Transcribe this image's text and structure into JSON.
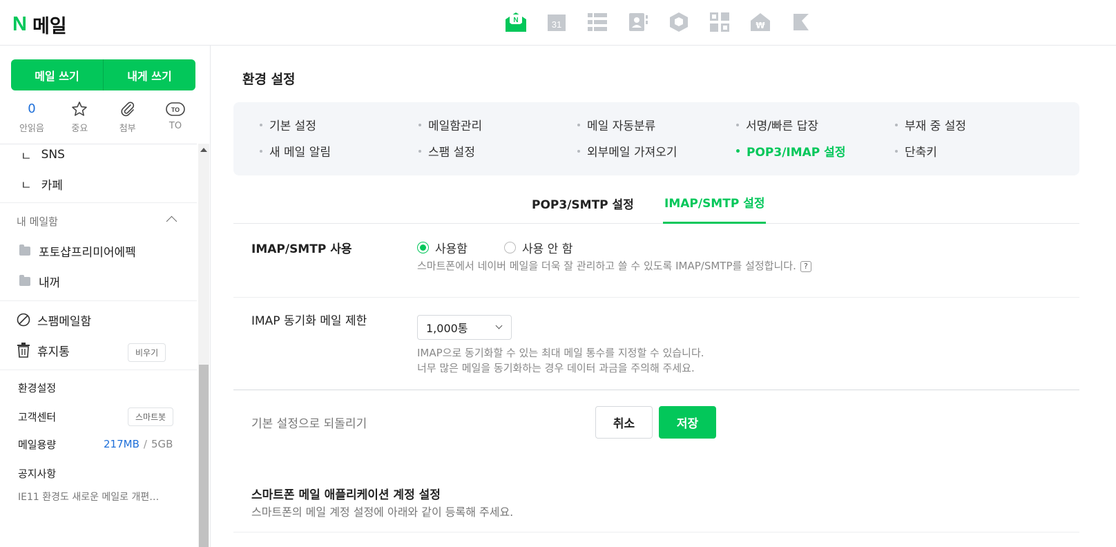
{
  "header": {
    "logo_letter": "N",
    "app_title": "메일",
    "apps": [
      "mail-icon",
      "calendar-icon",
      "list-icon",
      "contacts-icon",
      "box-icon",
      "grid-icon",
      "pay-icon",
      "bookmark-icon"
    ],
    "calendar_day": "31"
  },
  "sidebar": {
    "compose_label": "메일 쓰기",
    "self_label": "내게 쓰기",
    "quick": [
      {
        "value": "0",
        "label": "안읽음"
      },
      {
        "icon": "star-icon",
        "label": "중요"
      },
      {
        "icon": "clip-icon",
        "label": "첨부"
      },
      {
        "icon": "to-icon",
        "icon_text": "TO",
        "label": "TO"
      }
    ],
    "sub_items": [
      "SNS",
      "카페"
    ],
    "my_mailbox_label": "내 메일함",
    "folders": [
      "포토샵프리미어에펙",
      "내꺼"
    ],
    "spam_label": "스팸메일함",
    "trash_label": "휴지통",
    "trash_btn": "비우기",
    "settings_label": "환경설정",
    "support_label": "고객센터",
    "support_btn": "스마트봇",
    "storage_label": "메일용량",
    "storage_used": "217MB",
    "storage_sep": "/",
    "storage_total": "5GB",
    "notice_label": "공지사항",
    "notice_text": "IE11 환경도 새로운 메일로 개편…"
  },
  "main": {
    "title": "환경 설정",
    "menu": [
      [
        "기본 설정",
        "메일함관리",
        "메일 자동분류",
        "서명/빠른 답장",
        "부재 중 설정"
      ],
      [
        "새 메일 알림",
        "스팸 설정",
        "외부메일 가져오기",
        "POP3/IMAP 설정",
        "단축키"
      ]
    ],
    "tabs": [
      "POP3/SMTP 설정",
      "IMAP/SMTP 설정"
    ],
    "imap_use_label": "IMAP/SMTP 사용",
    "radio_on": "사용함",
    "radio_off": "사용 안 함",
    "imap_desc": "스마트폰에서 네이버 메일을 더욱 잘 관리하고 쓸 수 있도록 IMAP/SMTP를 설정합니다.",
    "help_glyph": "?",
    "sync_label": "IMAP 동기화 메일 제한",
    "sync_value": "1,000통",
    "sync_desc1": "IMAP으로 동기화할 수 있는 최대 메일 통수를 지정할 수 있습니다.",
    "sync_desc2": "너무 많은 메일을 동기화하는 경우 데이터 과금을 주의해 주세요.",
    "reset_label": "기본 설정으로 되돌리기",
    "cancel_label": "취소",
    "save_label": "저장",
    "section_title": "스마트폰 메일 애플리케이션 계정 설정",
    "section_desc": "스마트폰의 메일 계정 설정에 아래와 같이 등록해 주세요."
  },
  "colors": {
    "accent": "#03c75a",
    "link": "#1e6fd9"
  }
}
